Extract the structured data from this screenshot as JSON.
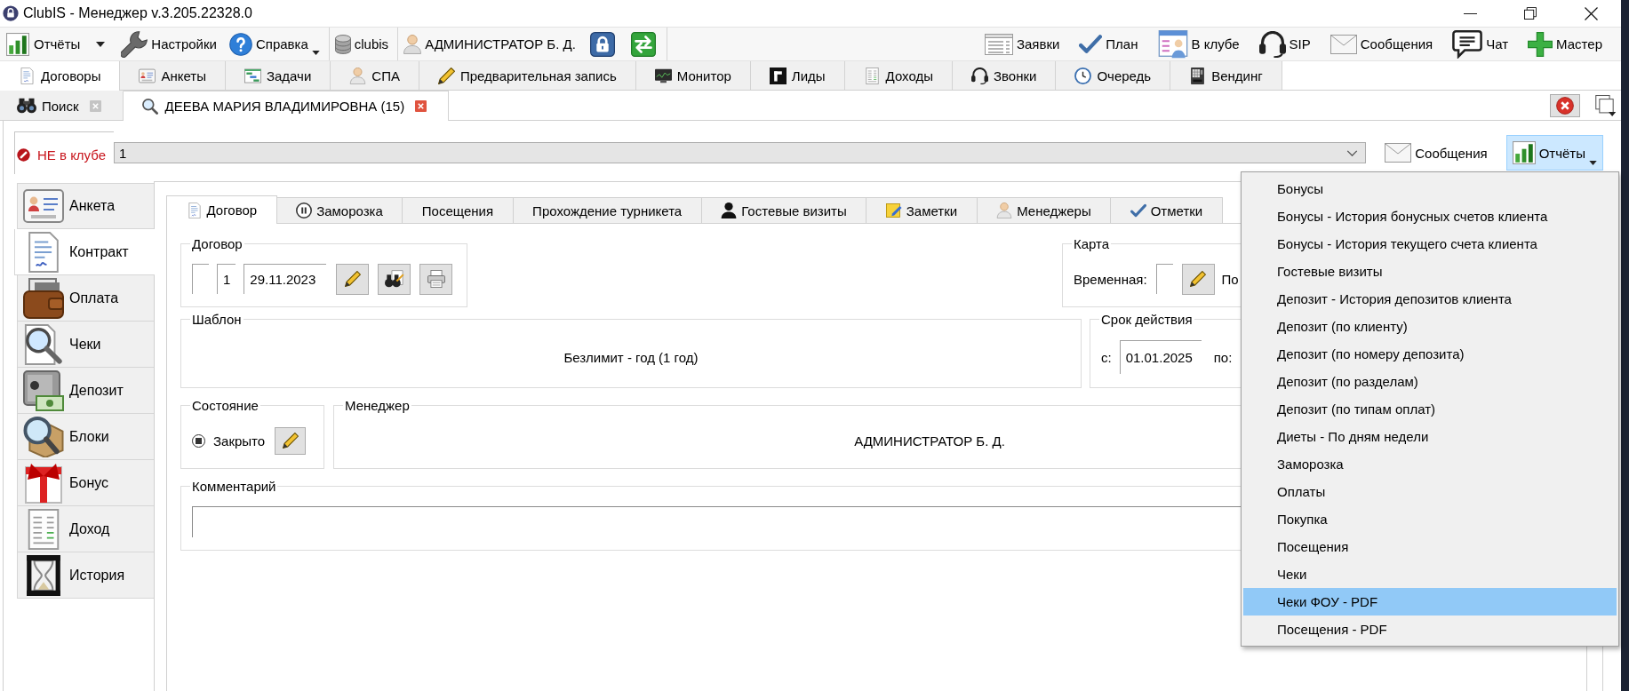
{
  "window": {
    "title": "ClubIS - Менеджер v.3.205.22328.0"
  },
  "toolbar": {
    "groups": [
      [
        {
          "kind": "split",
          "label": "Отчёты"
        },
        {
          "kind": "plain",
          "label": "Настройки"
        },
        {
          "kind": "menu",
          "label": "Справка"
        }
      ],
      [
        {
          "kind": "plain",
          "label": "clubis"
        }
      ],
      [
        {
          "kind": "plain",
          "label": "АДМИНИСТРАТОР Б. Д."
        },
        {
          "kind": "icon"
        },
        {
          "kind": "icon"
        }
      ]
    ],
    "right": [
      {
        "label": "Заявки"
      },
      {
        "label": "План"
      },
      {
        "label": "В клубе"
      },
      {
        "label": "SIP"
      },
      {
        "label": "Сообщения"
      },
      {
        "label": "Чат"
      },
      {
        "label": "Мастер"
      }
    ]
  },
  "module_tabs": [
    {
      "label": "Договоры",
      "selected": true
    },
    {
      "label": "Анкеты",
      "selected": false
    },
    {
      "label": "Задачи",
      "selected": false
    },
    {
      "label": "СПА",
      "selected": false
    },
    {
      "label": "Предварительная запись",
      "selected": false
    },
    {
      "label": "Монитор",
      "selected": false
    },
    {
      "label": "Лиды",
      "selected": false
    },
    {
      "label": "Доходы",
      "selected": false
    },
    {
      "label": "Звонки",
      "selected": false
    },
    {
      "label": "Очередь",
      "selected": false
    },
    {
      "label": "Вендинг",
      "selected": false
    }
  ],
  "document_tabs": [
    {
      "label": "Поиск",
      "selected": false
    },
    {
      "label": "ДЕЕВА МАРИЯ ВЛАДИМИРОВНА (15)",
      "selected": true
    }
  ],
  "client_bar": {
    "status": {
      "label": "НЕ в клубе",
      "in_club": false
    },
    "combo": {
      "value": "1"
    },
    "buttons": [
      {
        "kind": "plain",
        "label": "Сообщения",
        "pressed": false
      },
      {
        "kind": "menu",
        "label": "Отчёты",
        "pressed": true
      }
    ]
  },
  "side_nav": [
    {
      "label": "Анкета",
      "selected": false
    },
    {
      "label": "Контракт",
      "selected": true
    },
    {
      "label": "Оплата",
      "selected": false
    },
    {
      "label": "Чеки",
      "selected": false
    },
    {
      "label": "Депозит",
      "selected": false
    },
    {
      "label": "Блоки",
      "selected": false
    },
    {
      "label": "Бонус",
      "selected": false
    },
    {
      "label": "Доход",
      "selected": false
    },
    {
      "label": "История",
      "selected": false
    }
  ],
  "contract_tabs": [
    {
      "label": "Договор",
      "selected": true
    },
    {
      "label": "Заморозка",
      "selected": false
    },
    {
      "label": "Посещения",
      "selected": false
    },
    {
      "label": "Прохождение турникета",
      "selected": false
    },
    {
      "label": "Гостевые визиты",
      "selected": false
    },
    {
      "label": "Заметки",
      "selected": false
    },
    {
      "label": "Менеджеры",
      "selected": false
    },
    {
      "label": "Отметки",
      "selected": false
    }
  ],
  "contract_group": {
    "title": "Договор",
    "fields": [
      {
        "kind": "blank"
      },
      {
        "kind": "number",
        "value": "1"
      },
      {
        "kind": "date",
        "value": "29.11.2023"
      }
    ]
  },
  "card_group": {
    "title": "Карта",
    "label": "Временная:",
    "next_label": "По"
  },
  "template_group": {
    "title": "Шаблон",
    "value": "Безлимит - год (1 год)"
  },
  "validity_group": {
    "title": "Срок действия",
    "from_label": "с:",
    "from": "01.01.2025",
    "to_label": "по:"
  },
  "state_group": {
    "title": "Состояние",
    "option": {
      "label": "Закрыто",
      "selected": true
    }
  },
  "manager_group": {
    "title": "Менеджер",
    "value": "АДМИНИСТРАТОР Б. Д."
  },
  "comment_group": {
    "title": "Комментарий"
  },
  "reports_menu": {
    "items": [
      {
        "label": "Бонусы",
        "selected": false
      },
      {
        "label": "Бонусы - История бонусных счетов клиента",
        "selected": false
      },
      {
        "label": "Бонусы - История текущего счета клиента",
        "selected": false
      },
      {
        "label": "Гостевые визиты",
        "selected": false
      },
      {
        "label": "Депозит - История депозитов клиента",
        "selected": false
      },
      {
        "label": "Депозит (по клиенту)",
        "selected": false
      },
      {
        "label": "Депозит (по номеру депозита)",
        "selected": false
      },
      {
        "label": "Депозит (по разделам)",
        "selected": false
      },
      {
        "label": "Депозит (по типам оплат)",
        "selected": false
      },
      {
        "label": "Диеты - По дням недели",
        "selected": false
      },
      {
        "label": "Заморозка",
        "selected": false
      },
      {
        "label": "Оплаты",
        "selected": false
      },
      {
        "label": "Покупка",
        "selected": false
      },
      {
        "label": "Посещения",
        "selected": false
      },
      {
        "label": "Чеки",
        "selected": false
      },
      {
        "label": "Чеки ФОУ - PDF",
        "selected": true
      },
      {
        "label": "Посещения - PDF",
        "selected": false
      }
    ]
  }
}
